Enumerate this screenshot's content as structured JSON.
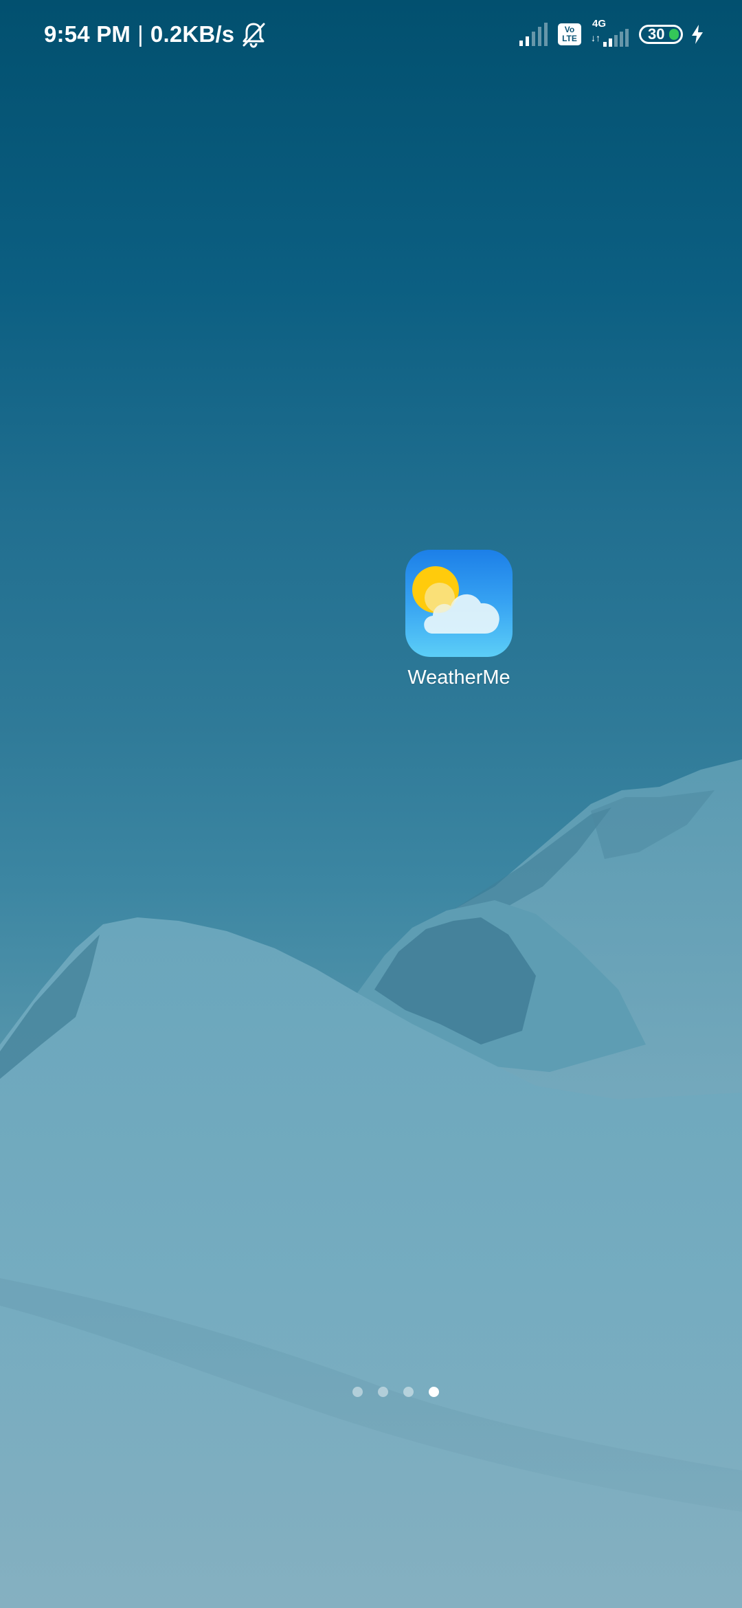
{
  "status_bar": {
    "time": "9:54 PM",
    "separator": "|",
    "net_speed": "0.2KB/s",
    "volte_top": "Vo",
    "volte_bottom": "LTE",
    "network_type": "4G",
    "network_arrows": "↓↑",
    "battery_level": "30",
    "icons": [
      "bell-muted-icon",
      "signal-icon",
      "volte-icon",
      "4g-signal-icon",
      "battery-icon",
      "charging-bolt-icon"
    ],
    "battery_color": "#34c759"
  },
  "home": {
    "apps": [
      {
        "label": "WeatherMe",
        "icon": "weather-sun-cloud-icon"
      }
    ],
    "page_count": 4,
    "active_page": 4
  },
  "colors": {
    "wallpaper_top": "#02506f",
    "wallpaper_bottom": "#82adbf",
    "app_icon_top": "#1c7fe8",
    "app_icon_bottom": "#5ccef7",
    "sun": "#ffcb0c"
  }
}
